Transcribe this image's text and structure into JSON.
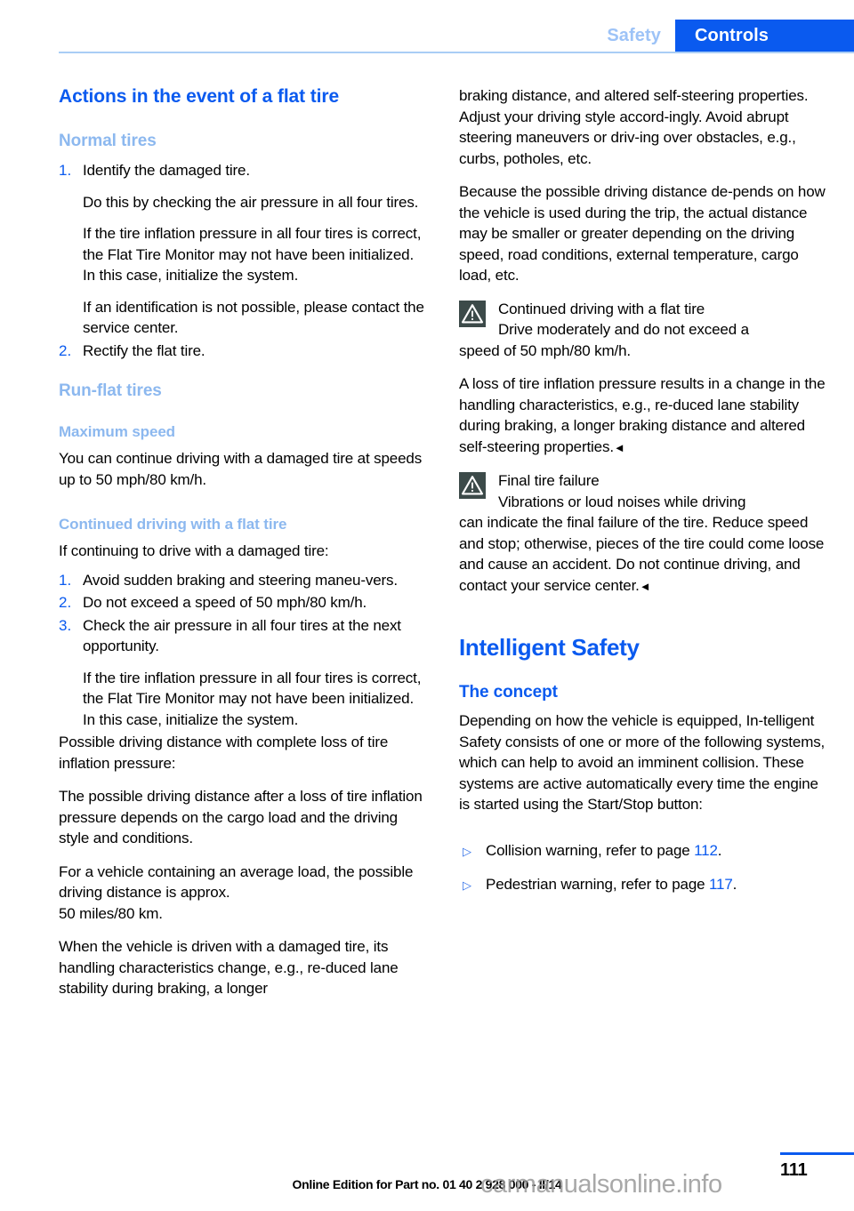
{
  "header": {
    "chapter": "Safety",
    "section": "Controls"
  },
  "left_column": {
    "chapter_title": "Actions in the event of a flat tire",
    "normal_tires": {
      "heading": "Normal tires",
      "steps": [
        {
          "marker": "1.",
          "paragraphs": [
            "Identify the damaged tire.",
            "Do this by checking the air pressure in all four tires.",
            "If the tire inflation pressure in all four tires is correct, the Flat Tire Monitor may not have been initialized. In this case, initialize the system.",
            "If an identification is not possible, please contact the service center."
          ]
        },
        {
          "marker": "2.",
          "paragraphs": [
            "Rectify the flat tire."
          ]
        }
      ]
    },
    "run_flat_tires": {
      "heading": "Run-flat tires",
      "maximum_speed": {
        "heading": "Maximum speed",
        "text": "You can continue driving with a damaged tire at speeds up to 50 mph/80 km/h."
      },
      "continued_driving": {
        "heading": "Continued driving with a flat tire",
        "intro": "If continuing to drive with a damaged tire:",
        "steps": [
          {
            "marker": "1.",
            "paragraphs": [
              "Avoid sudden braking and steering maneu‑vers."
            ]
          },
          {
            "marker": "2.",
            "paragraphs": [
              "Do not exceed a speed of 50 mph/80 km/h."
            ]
          },
          {
            "marker": "3.",
            "paragraphs": [
              "Check the air pressure in all four tires at the next opportunity.",
              "If the tire inflation pressure in all four tires is correct, the Flat Tire Monitor may not have been initialized. In this case, initialize the system."
            ]
          }
        ],
        "after_paragraphs": [
          "Possible driving distance with complete loss of tire inflation pressure:",
          "The possible driving distance after a loss of tire inflation pressure depends on the cargo load and the driving style and conditions.",
          "For a vehicle containing an average load, the possible driving distance is approx.\n50 miles/80 km.",
          "When the vehicle is driven with a damaged tire, its handling characteristics change, e.g., re‑duced lane stability during braking, a longer"
        ]
      }
    }
  },
  "right_column": {
    "continuation_paragraphs": [
      "braking distance, and altered self-steering properties. Adjust your driving style accord‑ingly. Avoid abrupt steering maneuvers or driv‑ing over obstacles, e.g., curbs, potholes, etc.",
      "Because the possible driving distance de‑pends on how the vehicle is used during the trip, the actual distance may be smaller or greater depending on the driving speed, road conditions, external temperature, cargo load, etc."
    ],
    "warnings": [
      {
        "icon": "warning-triangle-icon",
        "title": "Continued driving with a flat tire",
        "body_first_line": "Drive moderately and do not exceed a",
        "body_rest": "speed of 50 mph/80 km/h."
      },
      {
        "icon": "warning-triangle-icon",
        "title": "Final tire failure",
        "body_first_line": "Vibrations or loud noises while driving",
        "body_rest": "can indicate the final failure of the tire. Reduce speed and stop; otherwise, pieces of the tire could come loose and cause an accident. Do not continue driving, and contact your service center.",
        "end_mark": "◄"
      }
    ],
    "after_first_warning": {
      "text": "A loss of tire inflation pressure results in a change in the handling characteristics, e.g., re‑duced lane stability during braking, a longer braking distance and altered self-steering properties.",
      "end_mark": "◄"
    },
    "intelligent_safety": {
      "title": "Intelligent Safety",
      "concept_heading": "The concept",
      "concept_text": "Depending on how the vehicle is equipped, In‑telligent Safety consists of one or more of the following systems, which can help to avoid an imminent collision. These systems are active automatically every time the engine is started using the Start/Stop button:",
      "bullets": [
        {
          "marker": "▷",
          "text_before": "Collision warning, refer to page ",
          "page": "112",
          "text_after": "."
        },
        {
          "marker": "▷",
          "text_before": "Pedestrian warning, refer to page ",
          "page": "117",
          "text_after": "."
        }
      ]
    }
  },
  "footer": {
    "page_number": "111",
    "edition": "Online Edition for Part no. 01 40 2 928 000 - II/14",
    "watermark": "carmanualsonline.info"
  },
  "colors": {
    "accent_blue": "#0a5aef",
    "light_blue": "#8cb8ef",
    "header_chapter_blue": "#9dc3f7",
    "rule_blue": "#a9cdf5",
    "warning_icon_bg": "#3c4a49",
    "text_black": "#000000",
    "watermark_gray": "#9a9a9a"
  }
}
